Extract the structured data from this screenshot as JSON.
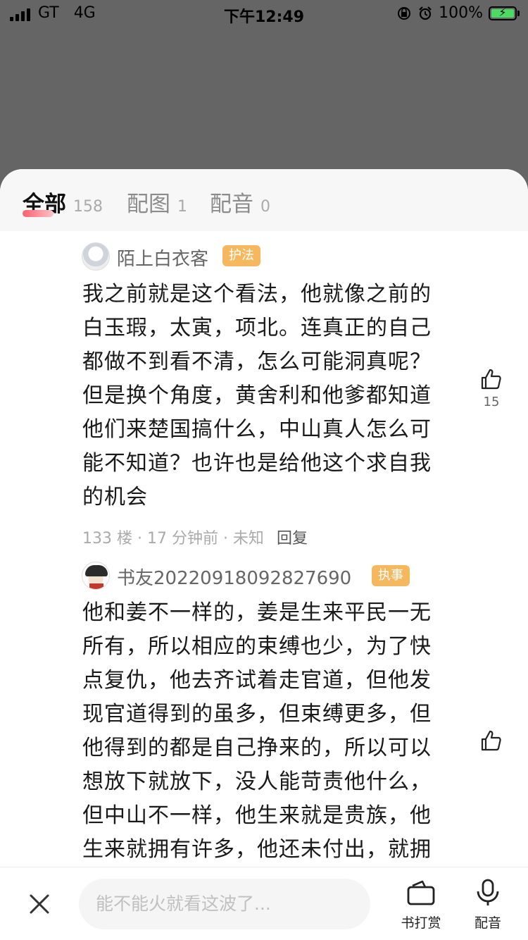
{
  "status_bar": {
    "carrier": "GT",
    "network": "4G",
    "time": "下午12:49",
    "battery": "100%",
    "status_icons": [
      "signal-icon",
      "orientation-lock-icon",
      "alarm-icon",
      "battery-charging-icon"
    ]
  },
  "tabs": [
    {
      "label": "全部",
      "count": "158",
      "active": true
    },
    {
      "label": "配图",
      "count": "1",
      "active": false
    },
    {
      "label": "配音",
      "count": "0",
      "active": false
    }
  ],
  "comments": [
    {
      "username": "陌上白衣客",
      "badge": "护法",
      "lines": [
        "我之前就是这个看法，他就像之前的",
        "白玉瑕，太寅，项北。连真正的自己",
        "都做不到看不清，怎么可能洞真呢？",
        "但是换个角度，黄舍利和他爹都知道",
        "他们来楚国搞什么，中山真人怎么可",
        "能不知道？也许也是给他这个求自我",
        "的机会"
      ],
      "meta": "133 楼 · 17 分钟前 · 未知",
      "reply_label": "回复",
      "likes": "15"
    },
    {
      "username": "书友20220918092827690",
      "badge": "执事",
      "lines": [
        "他和姜不一样的，姜是生来平民一无",
        "所有，所以相应的束缚也少，为了快",
        "点复仇，他去齐试着走官道，但他发",
        "现官道得到的虽多，但束缚更多，但",
        "他得到的都是自己挣来的，所以可以",
        "想放下就放下，没人能苛责他什么，",
        "但中山不一样，他生来就是贵族，他",
        "生来就拥有许多，他还未付出，就拥"
      ],
      "likes": ""
    }
  ],
  "bottom_bar": {
    "input_placeholder": "能不能火就看这波了...",
    "reward_label": "书打赏",
    "dubbing_label": "配音"
  }
}
